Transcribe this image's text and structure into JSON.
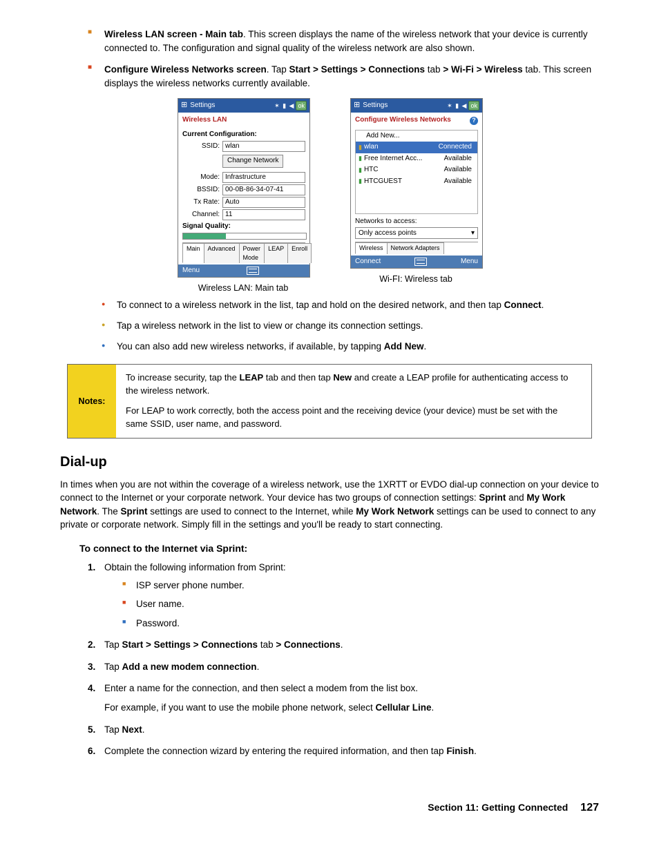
{
  "bullets": {
    "wlan_main_title": "Wireless LAN screen - Main tab",
    "wlan_main_text": ". This screen displays the name of the wireless network that your device is currently connected to. The configuration and signal quality of the wireless network are also shown.",
    "configure_title": "Configure Wireless Networks screen",
    "configure_text_pre": ". Tap ",
    "configure_path": "Start > Settings > Connections",
    "configure_mid1": " tab ",
    "configure_path2": "> Wi-Fi > Wireless",
    "configure_mid2": " tab. This screen displays the wireless networks currently available."
  },
  "screenshot1": {
    "title": "Settings",
    "ok": "ok",
    "header": "Wireless LAN",
    "current_cfg": "Current Configuration:",
    "fields": {
      "ssid_lbl": "SSID:",
      "ssid_val": "wlan",
      "change_btn": "Change Network",
      "mode_lbl": "Mode:",
      "mode_val": "Infrastructure",
      "bssid_lbl": "BSSID:",
      "bssid_val": "00-0B-86-34-07-41",
      "tx_lbl": "Tx Rate:",
      "tx_val": "Auto",
      "ch_lbl": "Channel:",
      "ch_val": "11"
    },
    "sig_quality": "Signal Quality:",
    "tabs": [
      "Main",
      "Advanced",
      "Power Mode",
      "LEAP",
      "Enroll"
    ],
    "menu": "Menu",
    "caption": "Wireless LAN: Main tab"
  },
  "screenshot2": {
    "title": "Settings",
    "ok": "ok",
    "header": "Configure Wireless Networks",
    "add_new": "Add New...",
    "networks": [
      {
        "name": "wlan",
        "status": "Connected",
        "sel": true
      },
      {
        "name": "Free Internet Acc...",
        "status": "Available"
      },
      {
        "name": "HTC",
        "status": "Available"
      },
      {
        "name": "HTCGUEST",
        "status": "Available"
      }
    ],
    "access_lbl": "Networks to access:",
    "access_val": "Only access points",
    "tabs": [
      "Wireless",
      "Network Adapters"
    ],
    "menubar_left": "Connect",
    "menubar_right": "Menu",
    "caption": "Wi-FI: Wireless tab"
  },
  "sub_bullets": {
    "b1_pre": "To connect to a wireless network in the list, tap and hold on the desired network, and then tap ",
    "b1_bold": "Connect",
    "b1_post": ".",
    "b2": "Tap a wireless network in the list to view or change its connection settings.",
    "b3_pre": "You can also add new wireless networks, if available, by tapping ",
    "b3_bold": "Add New",
    "b3_post": "."
  },
  "notes": {
    "label": "Notes:",
    "p1_pre": "To increase security, tap the ",
    "p1_b1": "LEAP",
    "p1_mid": " tab and then tap ",
    "p1_b2": "New",
    "p1_post": " and create a LEAP profile for authenticating access to the wireless network.",
    "p2": "For LEAP to work correctly, both the access point and the receiving device (your device) must be set with the same SSID, user name, and password."
  },
  "dialup": {
    "heading": "Dial-up",
    "para_pre": "In times when you are not within the coverage of a wireless network, use the 1XRTT or EVDO dial-up connection on your device to connect to the Internet or your corporate network. Your device has two groups of connection settings: ",
    "b1": "Sprint",
    "mid1": " and ",
    "b2": "My Work Network",
    "mid2": ". The ",
    "b3": "Sprint",
    "mid3": " settings are used to connect to the Internet, while ",
    "b4": "My Work Network",
    "mid4": " settings can be used to connect to any private or corporate network. Simply fill in the settings and you'll be ready to start connecting."
  },
  "subheading": "To connect to the Internet via Sprint:",
  "steps": {
    "s1": "Obtain the following information from Sprint:",
    "s1_items": [
      "ISP server phone number.",
      "User name.",
      "Password."
    ],
    "s2_pre": "Tap ",
    "s2_b1": "Start > Settings > Connections",
    "s2_mid": " tab ",
    "s2_b2": "> Connections",
    "s2_post": ".",
    "s3_pre": "Tap ",
    "s3_b": "Add a new modem connection",
    "s3_post": ".",
    "s4_main": "Enter a name for the connection, and then select a modem from the list box.",
    "s4_extra_pre": "For example, if you want to use the mobile phone network, select ",
    "s4_extra_b": "Cellular Line",
    "s4_extra_post": ".",
    "s5_pre": "Tap ",
    "s5_b": "Next",
    "s5_post": ".",
    "s6_pre": "Complete the connection wizard by entering the required information, and then tap ",
    "s6_b": "Finish",
    "s6_post": "."
  },
  "footer": {
    "section": "Section 11: Getting Connected",
    "page": "127"
  }
}
